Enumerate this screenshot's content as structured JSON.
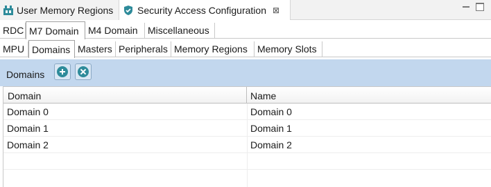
{
  "editor_tabs": [
    {
      "label": "User Memory Regions",
      "icon": "memory-regions-icon",
      "active": false
    },
    {
      "label": "Security Access Configuration",
      "icon": "security-shield-icon",
      "active": true,
      "close": "⊠"
    }
  ],
  "tab_row1": [
    {
      "label": "RDC",
      "selected": false
    },
    {
      "label": "M7 Domain",
      "selected": true
    },
    {
      "label": "M4 Domain",
      "selected": false
    },
    {
      "label": "Miscellaneous",
      "selected": false
    }
  ],
  "tab_row2": [
    {
      "label": "MPU",
      "selected": false
    },
    {
      "label": "Domains",
      "selected": true
    },
    {
      "label": "Masters",
      "selected": false
    },
    {
      "label": "Peripherals",
      "selected": false
    },
    {
      "label": "Memory Regions",
      "selected": false
    },
    {
      "label": "Memory Slots",
      "selected": false
    }
  ],
  "domains_bar": {
    "title": "Domains",
    "add_icon": "add-circle-icon",
    "remove_icon": "remove-circle-icon",
    "accent": "#2e8b9a",
    "background": "#c2d7ee"
  },
  "table": {
    "columns": [
      "Domain",
      "Name"
    ],
    "rows": [
      [
        "Domain 0",
        "Domain 0"
      ],
      [
        "Domain 1",
        "Domain 1"
      ],
      [
        "Domain 2",
        "Domain 2"
      ]
    ]
  }
}
